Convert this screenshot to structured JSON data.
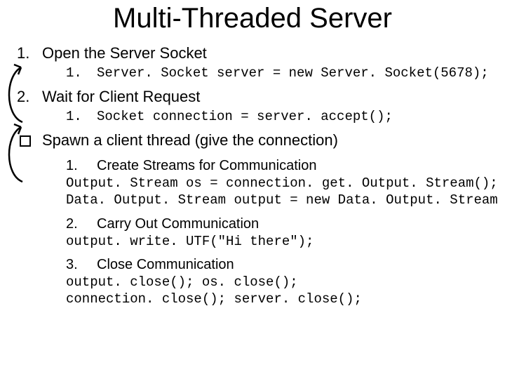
{
  "title": "Multi-Threaded Server",
  "step1": {
    "marker": "1.",
    "heading": "Open the Server Socket",
    "sub_marker": "1.",
    "sub_code": "Server. Socket server = new Server. Socket(5678);"
  },
  "step2": {
    "marker": "2.",
    "heading": "Wait for Client Request",
    "sub_marker": "1.",
    "sub_code": "Socket connection = server. accept();"
  },
  "step3": {
    "heading": "Spawn a client thread (give the connection)",
    "n1_marker": "1.",
    "n1_heading": "Create Streams for Communication",
    "n1_code": "Output. Stream os = connection. get. Output. Stream();\nData. Output. Stream output = new Data. Output. Stream (os);",
    "n2_marker": "2.",
    "n2_heading": "Carry Out Communication",
    "n2_code": "output. write. UTF(\"Hi there\");",
    "n3_marker": "3.",
    "n3_heading": "Close Communication",
    "n3_code": "output. close(); os. close();\nconnection. close(); server. close();"
  }
}
